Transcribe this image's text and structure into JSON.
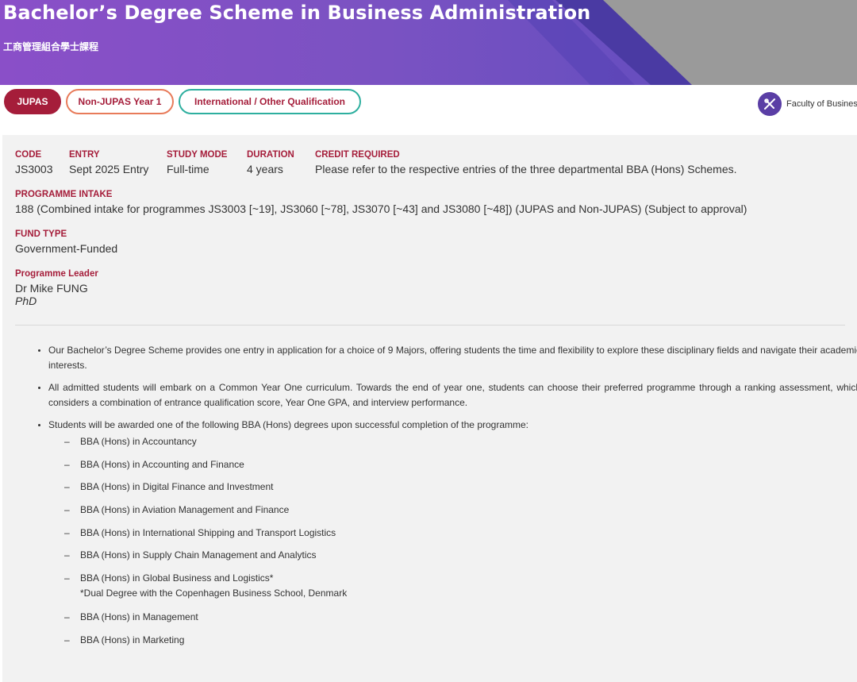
{
  "header": {
    "title": "Bachelor’s Degree Scheme in Business Administration",
    "subtitle": "工商管理組合學士課程"
  },
  "tabs": [
    {
      "label": "JUPAS",
      "active": true
    },
    {
      "label": "Non-JUPAS Year 1",
      "active": false
    },
    {
      "label": "International / Other Qualification",
      "active": false
    }
  ],
  "faculty": {
    "label": "Faculty of Business",
    "icon": "tools-icon"
  },
  "info": {
    "code": {
      "label": "CODE",
      "value": "JS3003"
    },
    "entry": {
      "label": "ENTRY",
      "value": "Sept 2025 Entry"
    },
    "study_mode": {
      "label": "STUDY MODE",
      "value": "Full-time"
    },
    "duration": {
      "label": "DURATION",
      "value": "4 years"
    },
    "credit": {
      "label": "CREDIT REQUIRED",
      "value": "Please refer to the respective entries of the three departmental BBA (Hons) Schemes."
    },
    "intake": {
      "label": "PROGRAMME INTAKE",
      "value": "188 (Combined intake for programmes JS3003 [~19], JS3060 [~78], JS3070 [~43] and JS3080 [~48]) (JUPAS and Non-JUPAS) (Subject to approval)"
    },
    "fund": {
      "label": "FUND TYPE",
      "value": "Government-Funded"
    },
    "leader": {
      "label": "Programme Leader",
      "name": "Dr Mike FUNG",
      "title": "PhD"
    }
  },
  "bullets": [
    "Our Bachelor’s Degree Scheme provides one entry in application for a choice of 9 Majors, offering students the time and flexibility to explore these disciplinary fields and navigate their academic interests.",
    "All admitted students will embark on a Common Year One curriculum. Towards the end of year one, students can choose their preferred programme through a ranking assessment, which considers a combination of entrance qualification score, Year One GPA, and interview performance.",
    "Students will be awarded one of the following BBA (Hons) degrees upon successful completion of the programme:"
  ],
  "degrees": [
    "BBA (Hons) in Accountancy",
    "BBA (Hons) in Accounting and Finance",
    "BBA (Hons) in Digital Finance and Investment",
    "BBA (Hons) in Aviation Management and Finance",
    "BBA (Hons) in International Shipping and Transport Logistics",
    "BBA (Hons) in Supply Chain Management and Analytics",
    "BBA (Hons) in Global Business and Logistics*",
    "BBA (Hons) in Management",
    "BBA (Hons) in Marketing"
  ],
  "degree_note": "*Dual Degree with the Copenhagen Business School, Denmark",
  "colors": {
    "accent": "#a51d3a",
    "banner": "#7a52c2",
    "tab_orange": "#e87b5a",
    "tab_teal": "#2eaf9f"
  }
}
